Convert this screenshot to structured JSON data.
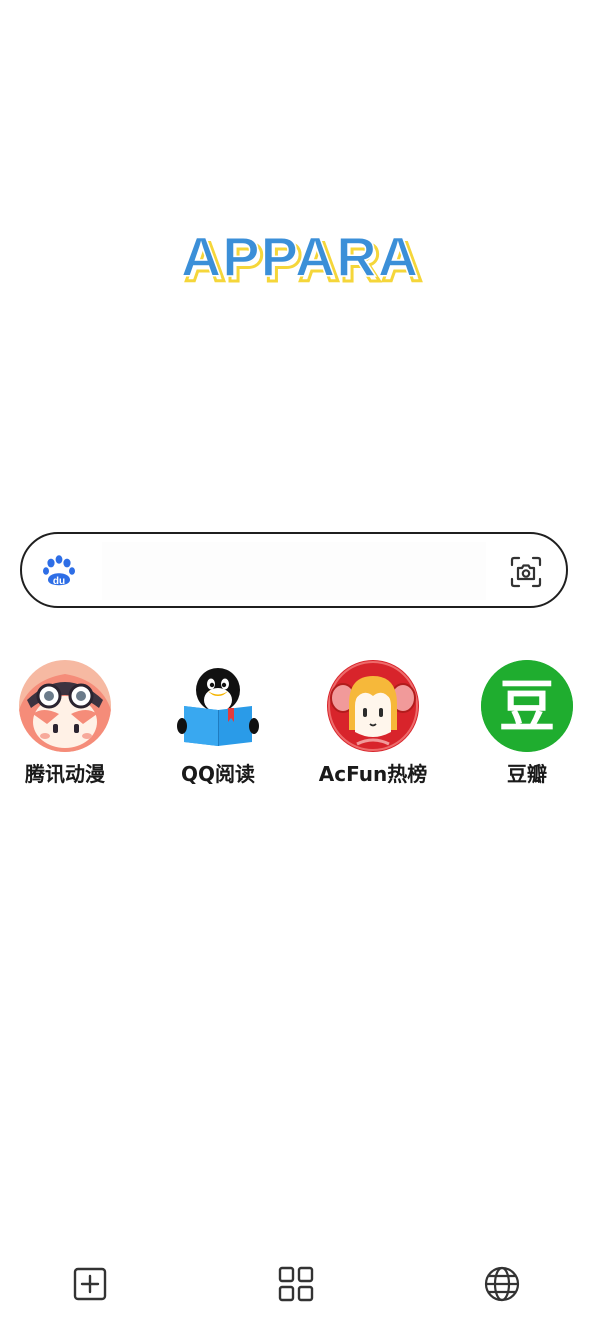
{
  "logo": {
    "text": "APPARA",
    "fill_color": "#3b8fd8",
    "outline_color": "#f5d63a"
  },
  "search": {
    "engine_icon": "baidu-paw-icon",
    "engine_icon_text": "du",
    "placeholder": "",
    "value": "",
    "camera_icon": "camera-scan-icon"
  },
  "shortcuts": [
    {
      "label": "腾讯动漫",
      "icon": "tencent-comic-icon"
    },
    {
      "label": "QQ阅读",
      "icon": "qq-reading-icon"
    },
    {
      "label": "AcFun热榜",
      "icon": "acfun-icon"
    },
    {
      "label": "豆瓣",
      "icon": "douban-icon",
      "icon_text": "豆"
    }
  ],
  "bottom_nav": {
    "add_icon": "add-box-icon",
    "apps_icon": "apps-grid-icon",
    "globe_icon": "globe-icon"
  },
  "colors": {
    "baidu_blue": "#2e6ee6",
    "douban_green": "#1fad2f",
    "acfun_red": "#d8242b",
    "search_border": "#1f1f1f"
  }
}
